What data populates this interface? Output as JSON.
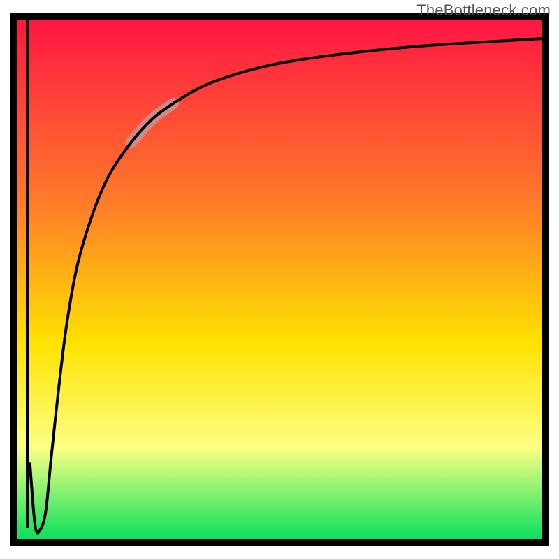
{
  "watermark": "TheBottleneck.com",
  "colors": {
    "gradient_top": "#ff1444",
    "gradient_mid1": "#ff7a2a",
    "gradient_mid2": "#ffe200",
    "gradient_mid3": "#fcff84",
    "gradient_bottom": "#00e05a",
    "curve": "#000000",
    "highlight": "#cc8a8a",
    "border": "#000000"
  },
  "chart_data": {
    "type": "line",
    "title": "",
    "xlabel": "",
    "ylabel": "",
    "xlim": [
      0,
      100
    ],
    "ylim": [
      0,
      100
    ],
    "description": "Bottleneck-style curve plotted over a vertical red-to-green gradient background.",
    "series": [
      {
        "name": "edge-spike",
        "comment": "Near-vertical line segment hugging the left border descending from top.",
        "x": [
          2.5,
          2.5
        ],
        "values": [
          100,
          3
        ]
      },
      {
        "name": "main-curve",
        "comment": "Bottleneck curve: sharp dip near x≈5 then asymptotic rise toward top-right.",
        "x": [
          3.0,
          4.0,
          5.0,
          6.0,
          7.0,
          8.5,
          10.0,
          12.0,
          15.0,
          18.0,
          22.0,
          26.0,
          30.0,
          35.0,
          40.0,
          47.0,
          55.0,
          65.0,
          75.0,
          85.0,
          95.0,
          100.0
        ],
        "values": [
          15.0,
          3.0,
          2.5,
          6.0,
          16.0,
          30.0,
          42.0,
          53.0,
          63.0,
          70.0,
          76.0,
          80.5,
          83.5,
          86.5,
          88.5,
          90.5,
          92.0,
          93.3,
          94.3,
          95.0,
          95.6,
          95.9
        ]
      }
    ],
    "highlight_segment": {
      "comment": "Short thick muted-pink band overlaid on the rising part of the curve.",
      "x": [
        22.0,
        26.0,
        30.0
      ],
      "values": [
        76.0,
        80.5,
        83.5
      ]
    }
  }
}
